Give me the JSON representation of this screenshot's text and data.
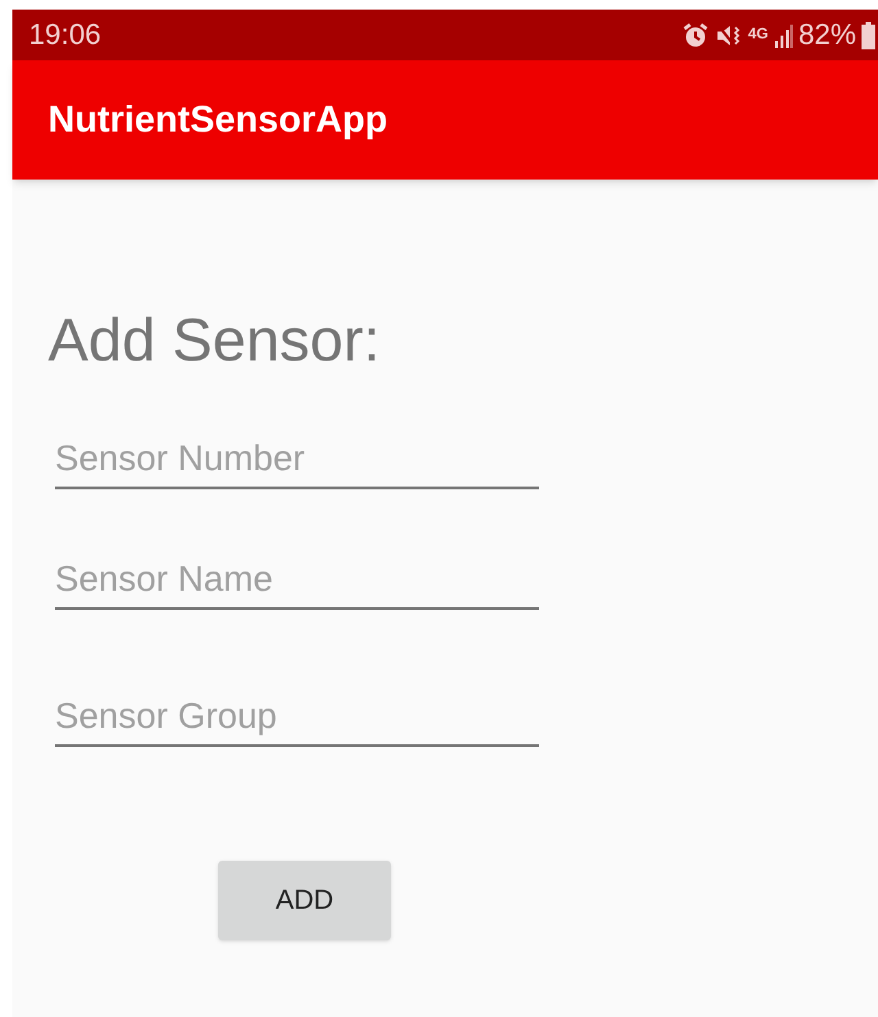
{
  "status_bar": {
    "time": "19:06",
    "network": "4G",
    "battery": "82%"
  },
  "app_bar": {
    "title": "NutrientSensorApp"
  },
  "heading": "Add Sensor:",
  "fields": [
    {
      "placeholder": "Sensor Number"
    },
    {
      "placeholder": "Sensor Name"
    },
    {
      "placeholder": "Sensor Group"
    }
  ],
  "button": "ADD"
}
